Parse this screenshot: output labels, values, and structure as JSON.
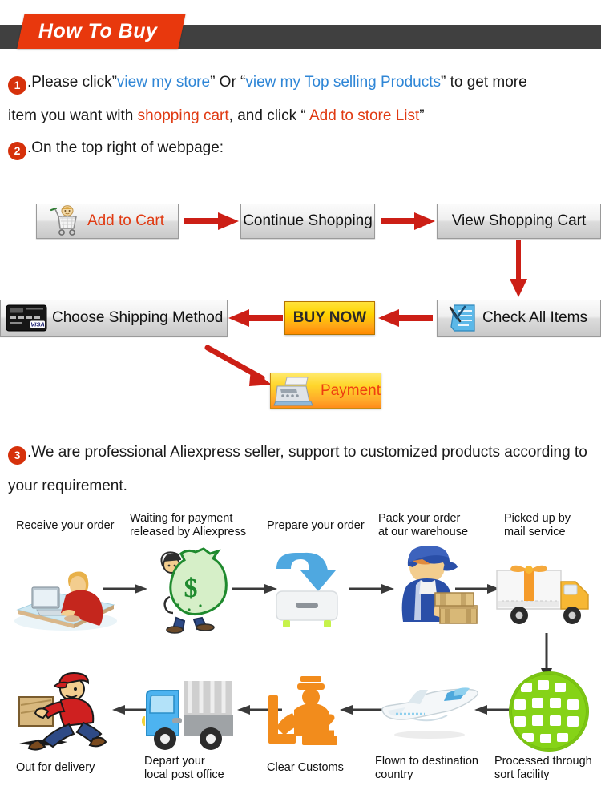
{
  "header": {
    "title": "How To Buy",
    "band_color": "#404040",
    "tag_color": "#e8380d"
  },
  "steps": [
    {
      "number": "1",
      "line1": {
        "pre": ".Please click”",
        "link1": "view my store",
        "mid1": "”  Or  “",
        "link2": "view my Top selling Products",
        "post": "”   to get more"
      },
      "line2": {
        "pre": "item you want with ",
        "highlight1": "shopping cart",
        "mid": ", and click  “ ",
        "highlight2": "Add to store List",
        "post": "”"
      }
    },
    {
      "number": "2",
      "text": ".On the top right of webpage:"
    },
    {
      "number": "3",
      "line1": ".We are professional Aliexpress seller, support to customized products according to",
      "line2": "your requirement."
    }
  ],
  "buy_flow": {
    "buttons": {
      "add_to_cart": "Add to Cart",
      "continue_shopping": "Continue Shopping",
      "view_shopping_cart": "View Shopping Cart",
      "check_all_items": "Check All Items",
      "buy_now": "BUY NOW",
      "choose_shipping_method": "Choose Shipping Method",
      "payment": "Payment"
    },
    "icons": {
      "cart": "shopping-cart-icon",
      "checklist": "checklist-icon",
      "credit_card": "credit-card-icon",
      "register": "cash-register-icon"
    },
    "arrow_color": "#cc1f16"
  },
  "shipping_flow": {
    "arrow_color": "#3a3a3a",
    "row1": [
      {
        "label": "Receive your order",
        "icon": "person-at-computer-icon"
      },
      {
        "label": "Waiting for payment\nreleased by Aliexpress",
        "label1": "Waiting for payment",
        "label2": "released by Aliexpress",
        "icon": "money-bag-icon"
      },
      {
        "label": "Prepare your order",
        "icon": "download-box-icon"
      },
      {
        "label": "Pack your order\nat our warehouse",
        "label1": "Pack your order",
        "label2": "at our warehouse",
        "icon": "worker-packing-icon"
      },
      {
        "label": "Picked up by\nmail service",
        "label1": "Picked up by",
        "label2": "mail service",
        "icon": "delivery-truck-icon"
      }
    ],
    "row2": [
      {
        "label": "Out for delivery",
        "icon": "courier-running-icon"
      },
      {
        "label": "Depart your\nlocal post office",
        "label1": "Depart your",
        "label2": "local post office",
        "icon": "post-truck-icon"
      },
      {
        "label": "Clear Customs",
        "icon": "customs-officer-icon"
      },
      {
        "label": "Flown to destination\ncountry",
        "label1": "Flown to destination",
        "label2": "country",
        "icon": "airplane-icon"
      },
      {
        "label": "Processed through\nsort facility",
        "label1": "Processed through",
        "label2": "sort facility",
        "icon": "globe-grid-icon"
      }
    ]
  }
}
